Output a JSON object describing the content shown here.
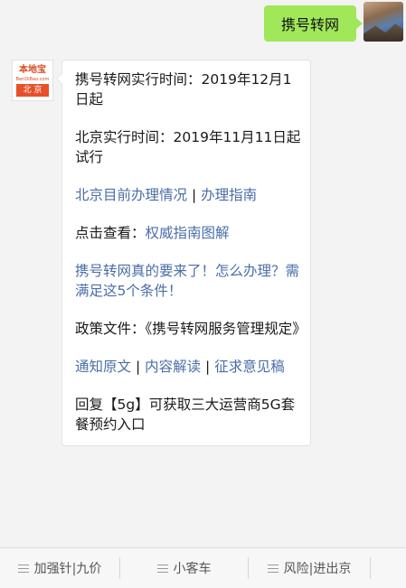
{
  "user_message": {
    "text": "携号转网"
  },
  "bot_avatar": {
    "logo_text": "本地宝",
    "logo_sub": "BenDiBao.com",
    "city": "北 京"
  },
  "message": {
    "p1": "携号转网实行时间：2019年12月1日起",
    "p2": "北京实行时间：2019年11月11日起试行",
    "p3": {
      "link1": "北京目前办理情况",
      "sep": " | ",
      "link2": "办理指南"
    },
    "p4": {
      "prefix": "点击查看：",
      "link": "权威指南图解"
    },
    "p5": {
      "link": "携号转网真的要来了！怎么办理？需满足这5个条件！"
    },
    "p6": "政策文件：《携号转网服务管理规定》",
    "p7": {
      "link1": "通知原文",
      "sep1": " | ",
      "link2": "内容解读",
      "sep2": " | ",
      "link3": "征求意见稿"
    },
    "p8": "回复【5g】可获取三大运营商5G套餐预约入口"
  },
  "menu": {
    "items": [
      "加强针|九价",
      "小客车",
      "风险|进出京"
    ]
  },
  "colors": {
    "bubble_green": "#a0e75a",
    "link_blue": "#4a6ea8",
    "background": "#f3f3f3"
  },
  "icons": [
    "hamburger-menu-icon"
  ]
}
